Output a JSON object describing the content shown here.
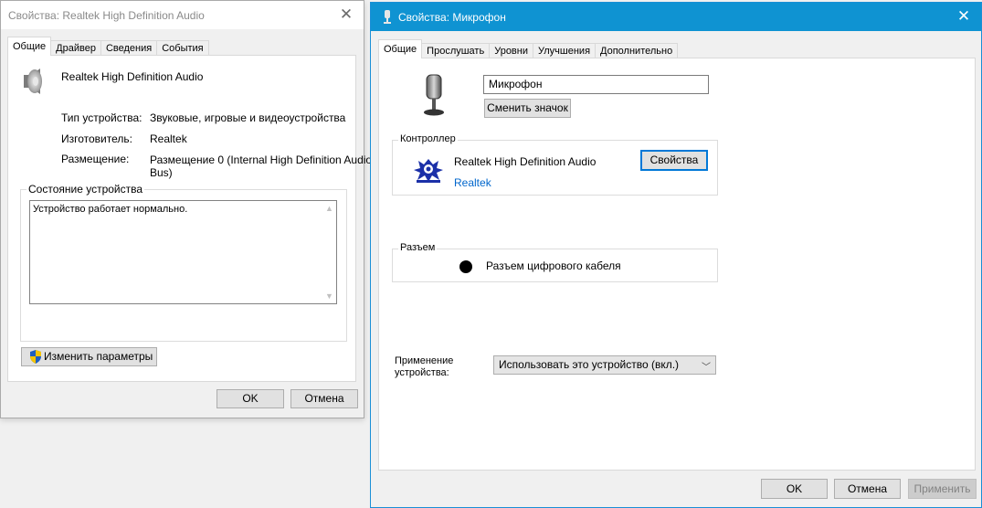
{
  "left_dialog": {
    "title": "Свойства: Realtek High Definition Audio",
    "tabs": [
      "Общие",
      "Драйвер",
      "Сведения",
      "События"
    ],
    "device_name": "Realtek High Definition Audio",
    "props": {
      "type_label": "Тип устройства:",
      "type_value": "Звуковые, игровые и видеоустройства",
      "maker_label": "Изготовитель:",
      "maker_value": "Realtek",
      "location_label": "Размещение:",
      "location_value_1": "Размещение 0 (Internal High Definition Audio",
      "location_value_2": "Bus)"
    },
    "status_group_title": "Состояние устройства",
    "status_text": "Устройство работает нормально.",
    "change_button": "Изменить параметры",
    "ok": "OK",
    "cancel": "Отмена"
  },
  "right_dialog": {
    "title": "Свойства: Микрофон",
    "tabs": [
      "Общие",
      "Прослушать",
      "Уровни",
      "Улучшения",
      "Дополнительно"
    ],
    "name_value": "Микрофон",
    "change_icon_button": "Сменить значок",
    "controller": {
      "title": "Контроллер",
      "name": "Realtek High Definition Audio",
      "link": "Realtek",
      "props_button": "Свойства"
    },
    "jack": {
      "title": "Разъем",
      "text": "Разъем цифрового кабеля"
    },
    "usage_label_1": "Применение",
    "usage_label_2": "устройства:",
    "usage_value": "Использовать это устройство (вкл.)",
    "ok": "OK",
    "cancel": "Отмена",
    "apply": "Применить"
  },
  "colors": {
    "titlebar_active": "#0f93d2",
    "link": "#0066cc",
    "focus": "#0078d7"
  }
}
